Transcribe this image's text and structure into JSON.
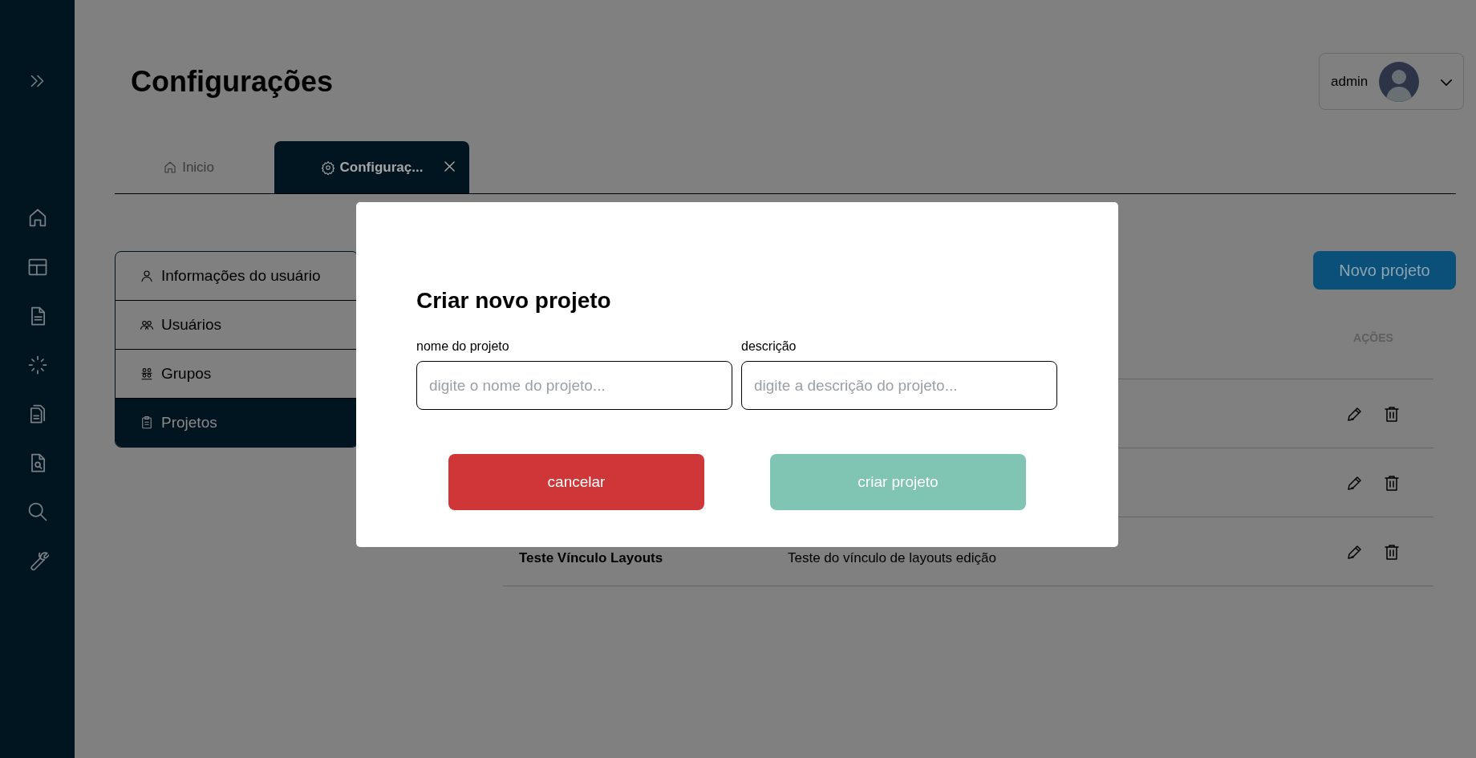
{
  "page": {
    "title": "Configurações"
  },
  "user_menu": {
    "name": "admin"
  },
  "tabs": [
    {
      "label": "Inicio",
      "selected": false,
      "closable": false
    },
    {
      "label": "Configuraç...",
      "selected": true,
      "closable": true
    }
  ],
  "settings_menu": [
    {
      "label": "Informações do usuário",
      "selected": false
    },
    {
      "label": "Usuários",
      "selected": false
    },
    {
      "label": "Grupos",
      "selected": false
    },
    {
      "label": "Projetos",
      "selected": true
    }
  ],
  "new_project_button": "Novo projeto",
  "table": {
    "columns": [
      {
        "label": "AÇÕES"
      }
    ],
    "rows": [
      {
        "kind": "actions_only"
      },
      {
        "kind": "actions_only"
      },
      {
        "kind": "full",
        "name": "Teste Vínculo Layouts",
        "description": "Teste do vínculo de layouts edição"
      }
    ]
  },
  "modal": {
    "title": "Criar novo projeto",
    "fields": [
      {
        "label": "nome do projeto",
        "placeholder": "digite o nome do projeto..."
      },
      {
        "label": "descrição",
        "placeholder": "digite a descrição do projeto..."
      }
    ],
    "buttons": [
      {
        "label": "cancelar",
        "kind": "danger"
      },
      {
        "label": "criar projeto",
        "kind": "primary"
      }
    ]
  }
}
